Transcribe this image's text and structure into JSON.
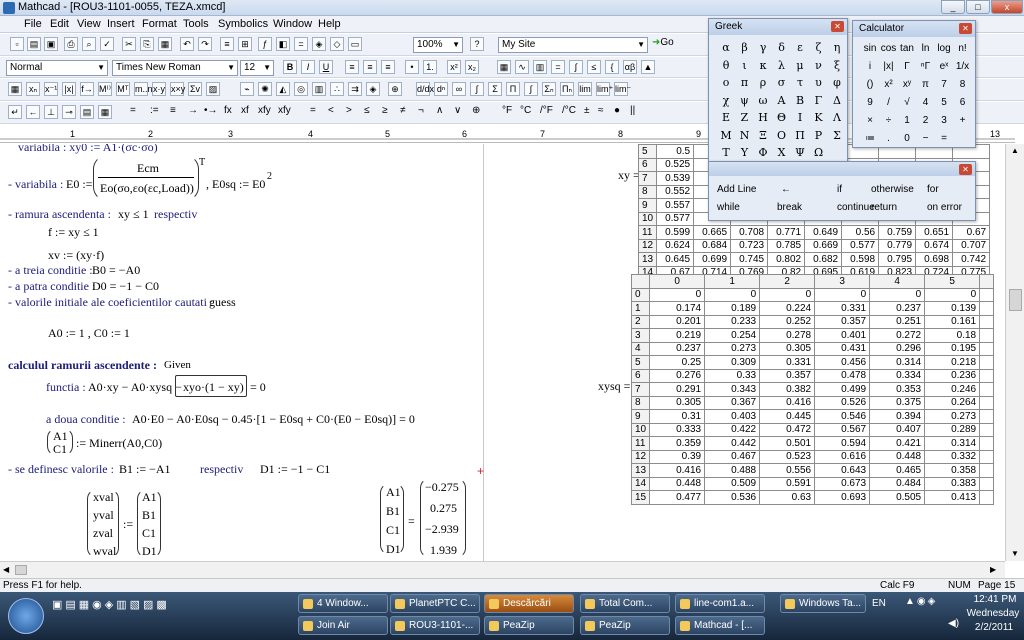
{
  "window": {
    "title": "Mathcad - [ROU3-1101-0055, TEZA.xmcd]",
    "min": "_",
    "max": "□",
    "close": "x"
  },
  "menu": [
    "File",
    "Edit",
    "View",
    "Insert",
    "Format",
    "Tools",
    "Symbolics",
    "Window",
    "Help"
  ],
  "toolbar1": {
    "zoom": "100%",
    "site": "My Site",
    "go": "Go"
  },
  "toolbar2": {
    "style": "Normal",
    "font": "Times New Roman",
    "size": "12",
    "bold": "B",
    "italic": "I",
    "underline": "U"
  },
  "toolbar4": {
    "ops": [
      "=",
      ":=",
      "≡",
      "→",
      "•→",
      "fx",
      "xf",
      "xfy",
      "xfy"
    ]
  },
  "toolbar5": {
    "units": [
      "°F",
      "°C",
      "/°F",
      "/°C",
      "±",
      "≈",
      "●",
      "||"
    ],
    "rel": [
      "=",
      "<",
      ">",
      "≤",
      "≥",
      "≠",
      "¬",
      "∧",
      "∨",
      "⊕"
    ]
  },
  "ruler": {
    "marks": [
      "1",
      "2",
      "3",
      "4",
      "5",
      "6",
      "7",
      "8",
      "9",
      "10",
      "11",
      "12",
      "13"
    ]
  },
  "doc": {
    "line0": "variabila : xy0 := A1·(σc·σo)",
    "line1_lbl": "- variabila :",
    "e0": "E0 :=",
    "ecm": "Ecm",
    "den": "Eo(σo,εo(εc,Load))",
    "exp": "T",
    "e0sq": ", E0sq := E0",
    "sq": "2",
    "line2_lbl": "- ramura ascendenta :",
    "line2_m": "xy ≤ 1",
    "line2_r": "respectiv",
    "f": "f := xy ≤ 1",
    "xv": "xv := (xy·f)",
    "l3": "- a treia conditie :",
    "l3m": "B0 = −A0",
    "l4": "- a patra conditie :",
    "l4m": "D0 = −1 − C0",
    "l5": "- valorile initiale ale coeficientilor cautati :",
    "l5m": "guess",
    "a0": "A0 := 1 ,  C0 := 1",
    "calc": "calculul ramurii ascendente :",
    "given": "Given",
    "func": "functia :",
    "funcm": "A0·xy − A0·xysq −",
    "funcv": "xyo·(1 − xy)",
    "funce": "= 0",
    "doua": "a doua conditie :",
    "douam": "A0·E0 − A0·E0sq − 0.45·[1 − E0sq + C0·(E0 − E0sq)] = 0",
    "a1": "A1",
    "c1": "C1",
    "minerr": ":= Minerr(A0,C0)",
    "defin": "- se definesc valorile :",
    "definm": "B1 := −A1",
    "resp": "respectiv",
    "definm2": "D1 := −1 − C1",
    "vlhs": [
      "xval",
      "yval",
      "zval",
      "wval"
    ],
    "vrhs": [
      "A1",
      "B1",
      "C1",
      "D1"
    ],
    "rlhs": [
      "A1",
      "B1",
      "C1",
      "D1"
    ],
    "rres": [
      "−0.275",
      "0.275",
      "−2.939",
      "1.939"
    ],
    "xylbl": "xy =",
    "xysqlbl": "xysq ="
  },
  "xy": {
    "rows": [
      [
        "5",
        "0.5",
        "",
        "",
        "",
        "",
        "",
        "",
        "",
        ""
      ],
      [
        "6",
        "0.525",
        "",
        "",
        "",
        "",
        "",
        "",
        "",
        ""
      ],
      [
        "7",
        "0.539",
        "",
        "",
        "",
        "",
        "",
        "",
        "",
        ""
      ],
      [
        "8",
        "0.552",
        "",
        "",
        "",
        "",
        "",
        "",
        "",
        ""
      ],
      [
        "9",
        "0.557",
        "",
        "",
        "",
        "",
        "",
        "",
        "",
        ""
      ],
      [
        "10",
        "0.577",
        "",
        "",
        "",
        "",
        "",
        "",
        "",
        ""
      ],
      [
        "11",
        "0.599",
        "0.665",
        "0.708",
        "0.771",
        "0.649",
        "0.56",
        "0.759",
        "0.651",
        "0.67"
      ],
      [
        "12",
        "0.624",
        "0.684",
        "0.723",
        "0.785",
        "0.669",
        "0.577",
        "0.779",
        "0.674",
        "0.707"
      ],
      [
        "13",
        "0.645",
        "0.699",
        "0.745",
        "0.802",
        "0.682",
        "0.598",
        "0.795",
        "0.698",
        "0.742"
      ],
      [
        "14",
        "0.67",
        "0.714",
        "0.769",
        "0.82",
        "0.695",
        "0.619",
        "0.823",
        "0.724",
        "0.775"
      ]
    ]
  },
  "xysq": {
    "header": [
      "",
      "0",
      "1",
      "2",
      "3",
      "4",
      "5",
      ""
    ],
    "rows": [
      [
        "0",
        "0",
        "0",
        "0",
        "0",
        "0",
        "0"
      ],
      [
        "1",
        "0.174",
        "0.189",
        "0.224",
        "0.331",
        "0.237",
        "0.139"
      ],
      [
        "2",
        "0.201",
        "0.233",
        "0.252",
        "0.357",
        "0.251",
        "0.161"
      ],
      [
        "3",
        "0.219",
        "0.254",
        "0.278",
        "0.401",
        "0.272",
        "0.18"
      ],
      [
        "4",
        "0.237",
        "0.273",
        "0.305",
        "0.431",
        "0.296",
        "0.195"
      ],
      [
        "5",
        "0.25",
        "0.309",
        "0.331",
        "0.456",
        "0.314",
        "0.218"
      ],
      [
        "6",
        "0.276",
        "0.33",
        "0.357",
        "0.478",
        "0.334",
        "0.236"
      ],
      [
        "7",
        "0.291",
        "0.343",
        "0.382",
        "0.499",
        "0.353",
        "0.246"
      ],
      [
        "8",
        "0.305",
        "0.367",
        "0.416",
        "0.526",
        "0.375",
        "0.264"
      ],
      [
        "9",
        "0.31",
        "0.403",
        "0.445",
        "0.546",
        "0.394",
        "0.273"
      ],
      [
        "10",
        "0.333",
        "0.422",
        "0.472",
        "0.567",
        "0.407",
        "0.289"
      ],
      [
        "11",
        "0.359",
        "0.442",
        "0.501",
        "0.594",
        "0.421",
        "0.314"
      ],
      [
        "12",
        "0.39",
        "0.467",
        "0.523",
        "0.616",
        "0.448",
        "0.332"
      ],
      [
        "13",
        "0.416",
        "0.488",
        "0.556",
        "0.643",
        "0.465",
        "0.358"
      ],
      [
        "14",
        "0.448",
        "0.509",
        "0.591",
        "0.673",
        "0.484",
        "0.383"
      ],
      [
        "15",
        "0.477",
        "0.536",
        "0.63",
        "0.693",
        "0.505",
        "0.413"
      ]
    ]
  },
  "greek": {
    "title": "Greek",
    "chars": [
      "α",
      "β",
      "γ",
      "δ",
      "ε",
      "ζ",
      "η",
      "θ",
      "ι",
      "κ",
      "λ",
      "μ",
      "ν",
      "ξ",
      "ο",
      "π",
      "ρ",
      "σ",
      "τ",
      "υ",
      "φ",
      "χ",
      "ψ",
      "ω",
      "Α",
      "Β",
      "Γ",
      "Δ",
      "Ε",
      "Ζ",
      "Η",
      "Θ",
      "Ι",
      "Κ",
      "Λ",
      "Μ",
      "Ν",
      "Ξ",
      "Ο",
      "Π",
      "Ρ",
      "Σ",
      "Τ",
      "Υ",
      "Φ",
      "Χ",
      "Ψ",
      "Ω"
    ]
  },
  "calc": {
    "title": "Calculator",
    "keys": [
      "sin",
      "cos",
      "tan",
      "ln",
      "log",
      "n!",
      "i",
      "|x|",
      "Γ",
      "ⁿΓ",
      "eˣ",
      "1/x",
      "()",
      "x²",
      "xʸ",
      "π",
      "7",
      "8",
      "9",
      "/",
      "√",
      "4",
      "5",
      "6",
      "×",
      "÷",
      "1",
      "2",
      "3",
      "+",
      "≔",
      ".",
      "0",
      "−",
      "="
    ]
  },
  "prog": {
    "keys": [
      "Add Line",
      "←",
      "if",
      "otherwise",
      "for",
      "while",
      "break",
      "continue",
      "return",
      "on error"
    ]
  },
  "status": {
    "help": "Press F1 for help.",
    "calc": "Calc F9",
    "num": "NUM",
    "page": "Page 15"
  },
  "taskbar": {
    "items": [
      "4 Window...",
      "PlanetPTC C...",
      "Descărcări",
      "Total Com...",
      "line-com1.a...",
      "Windows Ta...",
      "Join Air",
      "ROU3-1101-...",
      "PeaZip",
      "PeaZip",
      "Mathcad - [..."
    ],
    "lang": "EN",
    "time": "12:41 PM",
    "day": "Wednesday",
    "date": "2/2/2011"
  }
}
